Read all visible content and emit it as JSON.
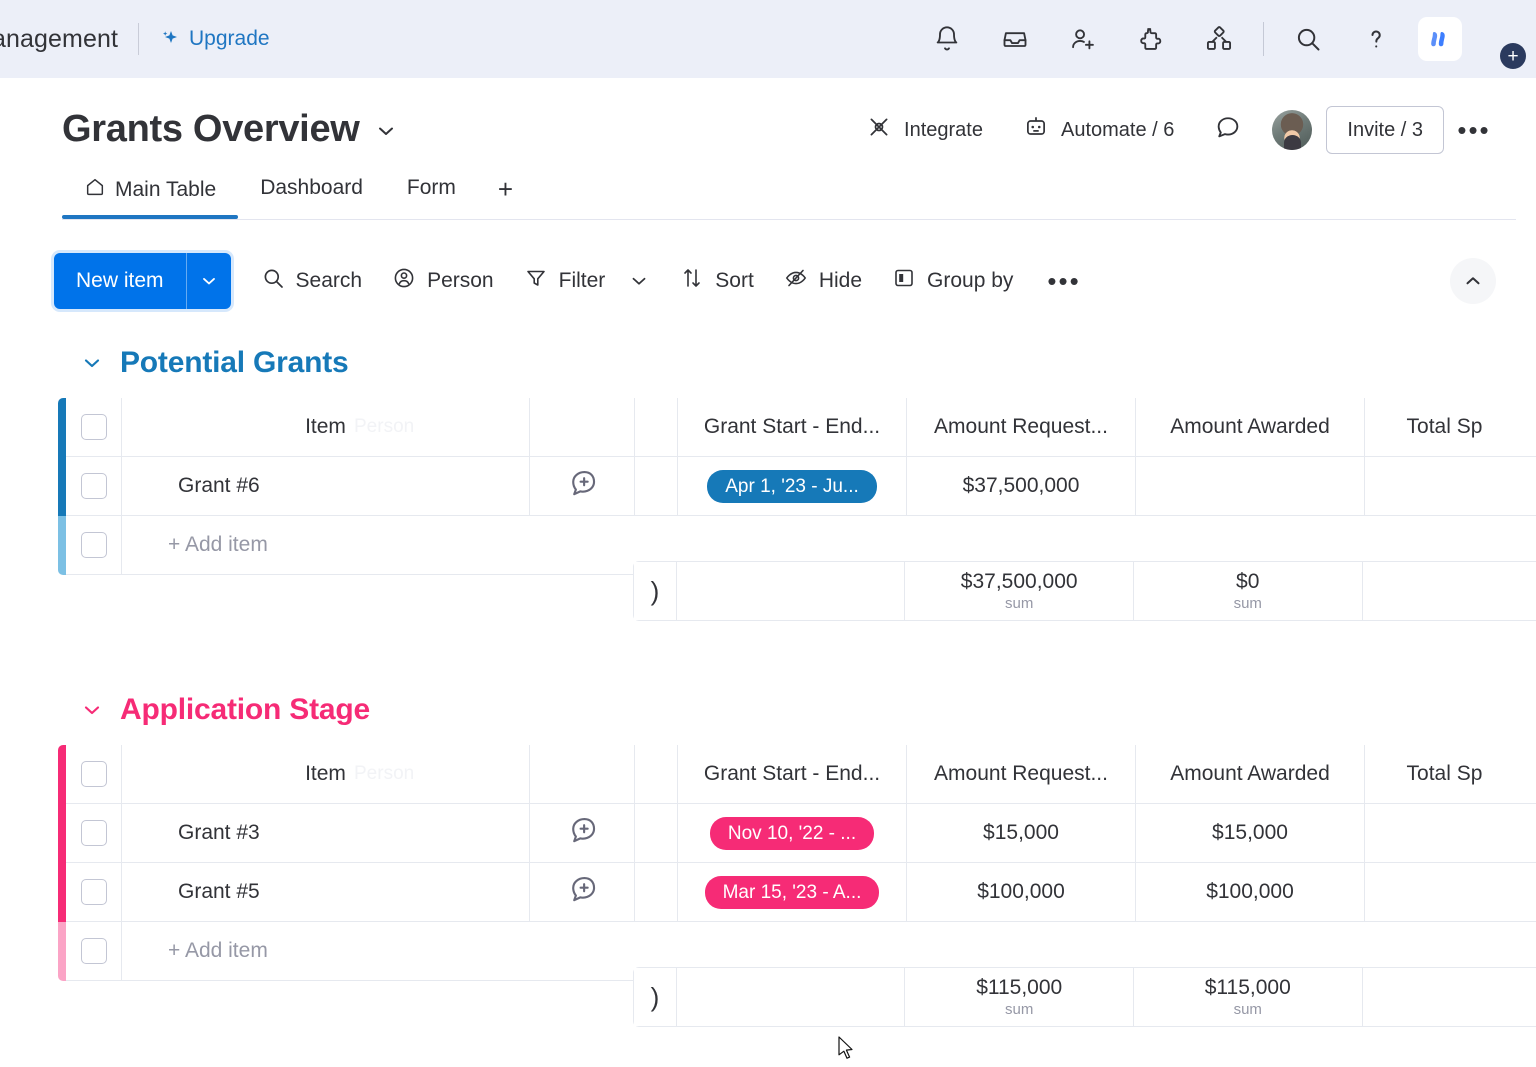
{
  "topbar": {
    "workspace_name": "anagement",
    "upgrade_label": "Upgrade",
    "icons": [
      {
        "name": "notifications-icon"
      },
      {
        "name": "inbox-icon"
      },
      {
        "name": "invite-member-icon"
      },
      {
        "name": "apps-marketplace-icon"
      },
      {
        "name": "product-switcher-icon"
      },
      {
        "name": "search-icon"
      },
      {
        "name": "help-icon"
      }
    ]
  },
  "board": {
    "title": "Grants Overview",
    "integrate_label": "Integrate",
    "automate_label": "Automate / 6",
    "invite_label": "Invite / 3",
    "more_label": "•••"
  },
  "tabs": [
    {
      "label": "Main Table",
      "icon": "home-icon",
      "active": true
    },
    {
      "label": "Dashboard",
      "active": false
    },
    {
      "label": "Form",
      "active": false
    }
  ],
  "tab_add_label": "+",
  "toolbar": {
    "new_item_label": "New item",
    "search_label": "Search",
    "person_label": "Person",
    "filter_label": "Filter",
    "sort_label": "Sort",
    "hide_label": "Hide",
    "group_by_label": "Group by",
    "more_label": "•••"
  },
  "columns": {
    "item": "Item",
    "date": "Grant Start - End...",
    "requested": "Amount Request...",
    "awarded": "Amount Awarded",
    "total": "Total Sp",
    "item_hint": "Person"
  },
  "add_item_label": "+ Add item",
  "sum_label": "sum",
  "close_paren": ")",
  "groups": [
    {
      "name": "Potential Grants",
      "color": "#1679b8",
      "color_light": "#7cc0e4",
      "rows": [
        {
          "item": "Grant #6",
          "date": "Apr 1, '23 - Ju...",
          "requested": "$37,500,000",
          "awarded": "",
          "total": ""
        }
      ],
      "summary": {
        "requested": "$37,500,000",
        "awarded": "$0",
        "total": ""
      }
    },
    {
      "name": "Application Stage",
      "color": "#f62b76",
      "color_light": "#fba4c6",
      "rows": [
        {
          "item": "Grant #3",
          "date": "Nov 10, '22 - ...",
          "requested": "$15,000",
          "awarded": "$15,000",
          "total": ""
        },
        {
          "item": "Grant #5",
          "date": "Mar 15, '23 - A...",
          "requested": "$100,000",
          "awarded": "$100,000",
          "total": ""
        }
      ],
      "summary": {
        "requested": "$115,000",
        "awarded": "$115,000",
        "total": ""
      }
    }
  ]
}
